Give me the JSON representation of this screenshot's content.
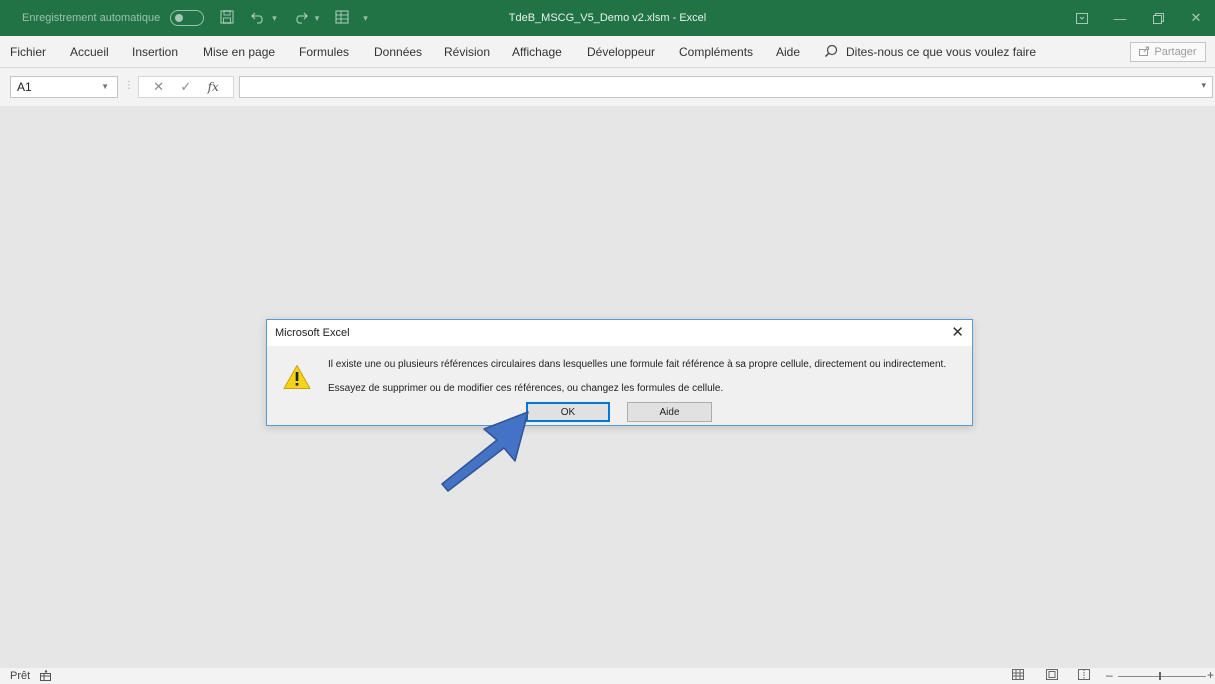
{
  "titlebar": {
    "autosave_label": "Enregistrement automatique",
    "doc_title": "TdeB_MSCG_V5_Demo v2.xlsm  -  Excel"
  },
  "ribbon": {
    "tabs": [
      "Fichier",
      "Accueil",
      "Insertion",
      "Mise en page",
      "Formules",
      "Données",
      "Révision",
      "Affichage",
      "Développeur",
      "Compléments",
      "Aide"
    ],
    "tell_me": "Dites-nous ce que vous voulez faire",
    "share": "Partager"
  },
  "formula_bar": {
    "name_box": "A1",
    "fx": "fx",
    "value": ""
  },
  "dialog": {
    "title": "Microsoft Excel",
    "message_line1": "Il existe une ou plusieurs références circulaires dans lesquelles une formule fait référence à sa propre cellule, directement ou indirectement.",
    "message_line2": "Essayez de supprimer ou de modifier ces références, ou changez les formules de cellule.",
    "ok_label": "OK",
    "help_label": "Aide",
    "icon": "warning-icon"
  },
  "annotation": {
    "icon": "arrow-pointer",
    "color": "#4472c4"
  },
  "statusbar": {
    "status": "Prêt"
  },
  "colors": {
    "excel_green": "#217346",
    "dialog_border": "#5a9bd5",
    "ok_focus": "#0078d7"
  }
}
